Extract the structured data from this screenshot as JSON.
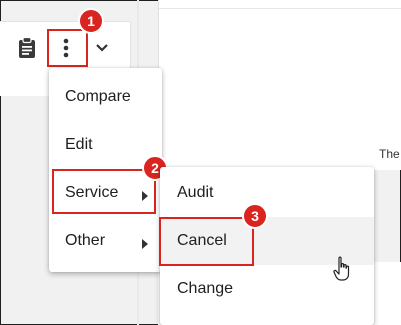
{
  "toolbar": {
    "icons": [
      "clipboard-icon",
      "more-vert-icon",
      "chevron-down-icon"
    ]
  },
  "background": {
    "partial_text": "The"
  },
  "menu": {
    "items": [
      {
        "label": "Compare"
      },
      {
        "label": "Edit"
      },
      {
        "label": "Service"
      },
      {
        "label": "Other"
      }
    ]
  },
  "submenu": {
    "items": [
      {
        "label": "Audit"
      },
      {
        "label": "Cancel"
      },
      {
        "label": "Change"
      }
    ]
  },
  "steps": {
    "one": "1",
    "two": "2",
    "three": "3"
  },
  "colors": {
    "highlight": "#d9241f",
    "hover_bg": "#f2f2f2"
  }
}
